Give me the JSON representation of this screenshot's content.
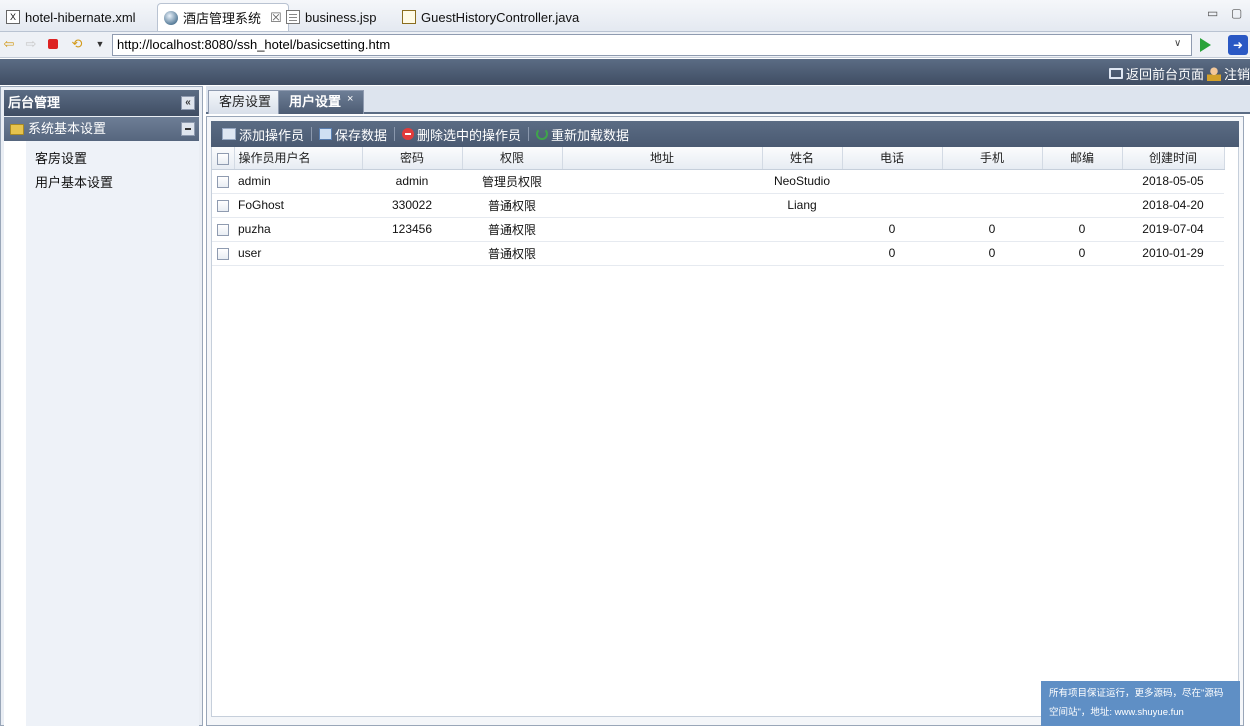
{
  "ide": {
    "tabs": [
      {
        "label": "hotel-hibernate.xml",
        "icon": "xml-file-icon"
      },
      {
        "label": "酒店管理系统",
        "icon": "browser-globe-icon",
        "active": true
      },
      {
        "label": "business.jsp",
        "icon": "jsp-file-icon"
      },
      {
        "label": "GuestHistoryController.java",
        "icon": "java-file-icon"
      }
    ],
    "close_glyph": "☒",
    "minimize_glyph": "▭",
    "maximize_glyph": "▢"
  },
  "browser": {
    "url": "http://localhost:8080/ssh_hotel/basicsetting.htm"
  },
  "header": {
    "back_front_label": "返回前台页面",
    "logout_label": "注销"
  },
  "sidebar": {
    "title": "后台管理",
    "collapse_glyph": "«",
    "section_title": "系统基本设置",
    "items": [
      {
        "label": "客房设置"
      },
      {
        "label": "用户基本设置"
      }
    ]
  },
  "main": {
    "tabs": [
      {
        "label": "客房设置",
        "active": false
      },
      {
        "label": "用户设置",
        "active": true,
        "close_glyph": "×"
      }
    ],
    "toolbar": {
      "add_label": "添加操作员",
      "save_label": "保存数据",
      "delete_label": "删除选中的操作员",
      "reload_label": "重新加载数据"
    },
    "grid": {
      "columns": [
        "操作员用户名",
        "密码",
        "权限",
        "地址",
        "姓名",
        "电话",
        "手机",
        "邮编",
        "创建时间"
      ],
      "rows": [
        [
          "admin",
          "admin",
          "管理员权限",
          "",
          "NeoStudio",
          "",
          "",
          "",
          "2018-05-05"
        ],
        [
          "FoGhost",
          "330022",
          "普通权限",
          "",
          "Liang",
          "",
          "",
          "",
          "2018-04-20"
        ],
        [
          "puzha",
          "123456",
          "普通权限",
          "",
          "",
          "0",
          "0",
          "0",
          "2019-07-04"
        ],
        [
          "user",
          "",
          "普通权限",
          "",
          "",
          "0",
          "0",
          "0",
          "2010-01-29"
        ]
      ]
    }
  },
  "footer": {
    "line1": "所有项目保证运行，更多源码，尽在\"源码",
    "line2": "空间站\"，地址: www.shuyue.fun"
  },
  "colors": {
    "header_bg": "#4a5a72",
    "footer_bg": "#5f8fc5"
  }
}
